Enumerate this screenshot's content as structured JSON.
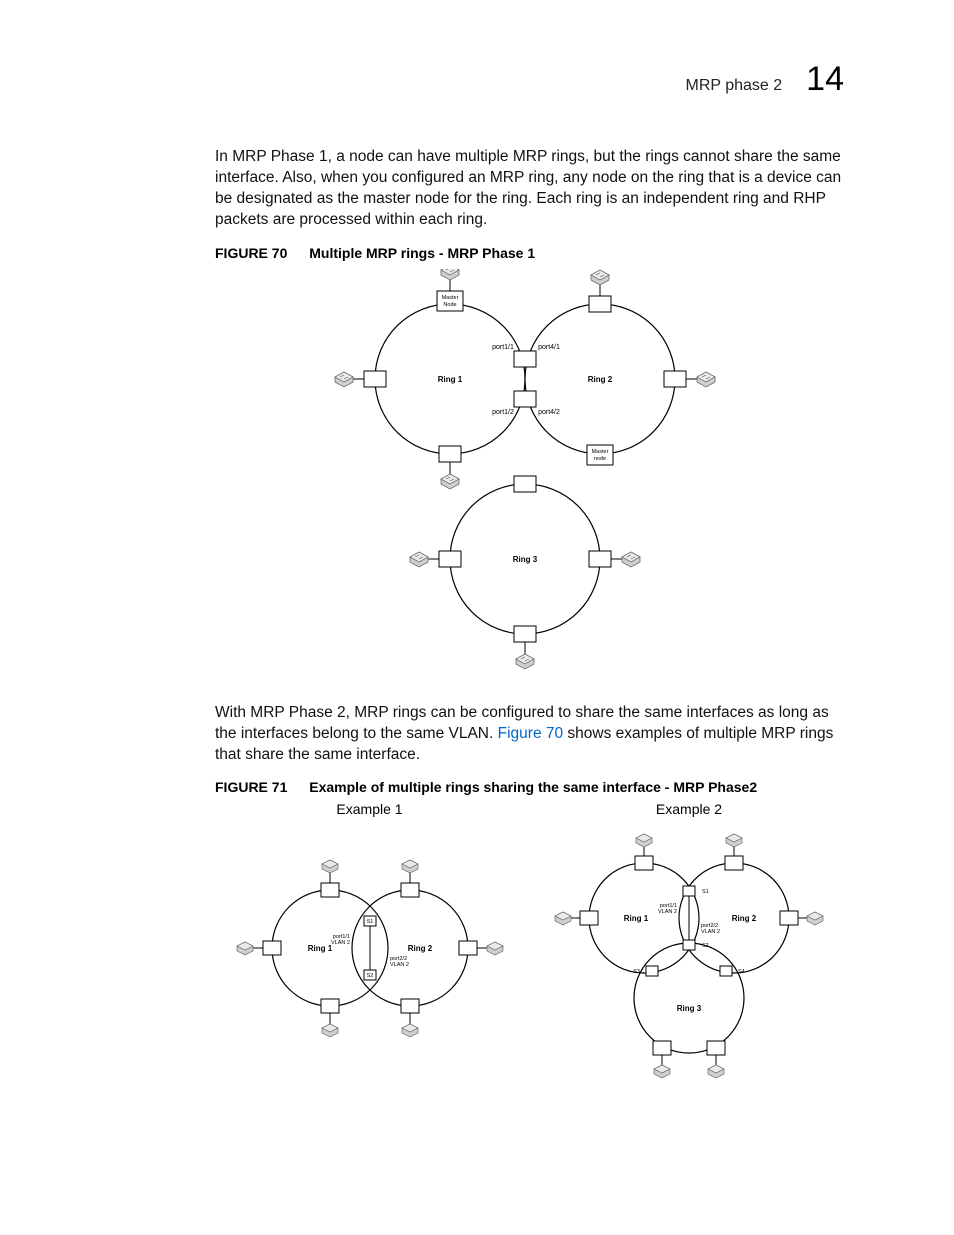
{
  "header": {
    "title": "MRP phase 2",
    "chapter": "14"
  },
  "para1": "In MRP Phase 1, a node can have multiple MRP rings, but the rings cannot share the same interface. Also, when you configured an MRP ring, any node on the ring that is a device can be designated as the master node for the ring. Each ring is an independent ring and RHP packets are processed within each ring.",
  "figure70": {
    "no": "FIGURE 70",
    "title": "Multiple MRP rings - MRP Phase 1",
    "diagram": {
      "type": "three-ring-mrp-phase1",
      "rings": [
        "Ring 1",
        "Ring 2",
        "Ring 3"
      ],
      "ring1_ring2_interface_labels": [
        "port1/1",
        "port4/1",
        "port1/2",
        "port4/2"
      ],
      "master_nodes": [
        "Master Node",
        "Master node"
      ]
    }
  },
  "para2_pre": "With MRP Phase 2, MRP rings can be configured to share the same interfaces as long as the interfaces belong to the same VLAN. ",
  "para2_link": "Figure 70",
  "para2_post": " shows examples of multiple MRP rings that share the same interface.",
  "figure71": {
    "no": "FIGURE 71",
    "title": "Example of multiple rings sharing the same interface - MRP Phase2",
    "examples": {
      "ex1": {
        "label": "Example 1",
        "type": "two-overlapping-rings",
        "rings": [
          "Ring 1",
          "Ring 2"
        ],
        "shared_nodes": [
          "S1",
          "S2"
        ],
        "port_labels": [
          "port1/1 VLAN 2",
          "port2/2 VLAN 2"
        ]
      },
      "ex2": {
        "label": "Example 2",
        "type": "three-overlapping-rings",
        "rings": [
          "Ring 1",
          "Ring 2",
          "Ring 3"
        ],
        "shared_nodes": [
          "S1",
          "S2",
          "S3",
          "S4"
        ],
        "port_labels": [
          "port1/1 VLAN 2",
          "port2/2 VLAN 2"
        ]
      }
    }
  }
}
